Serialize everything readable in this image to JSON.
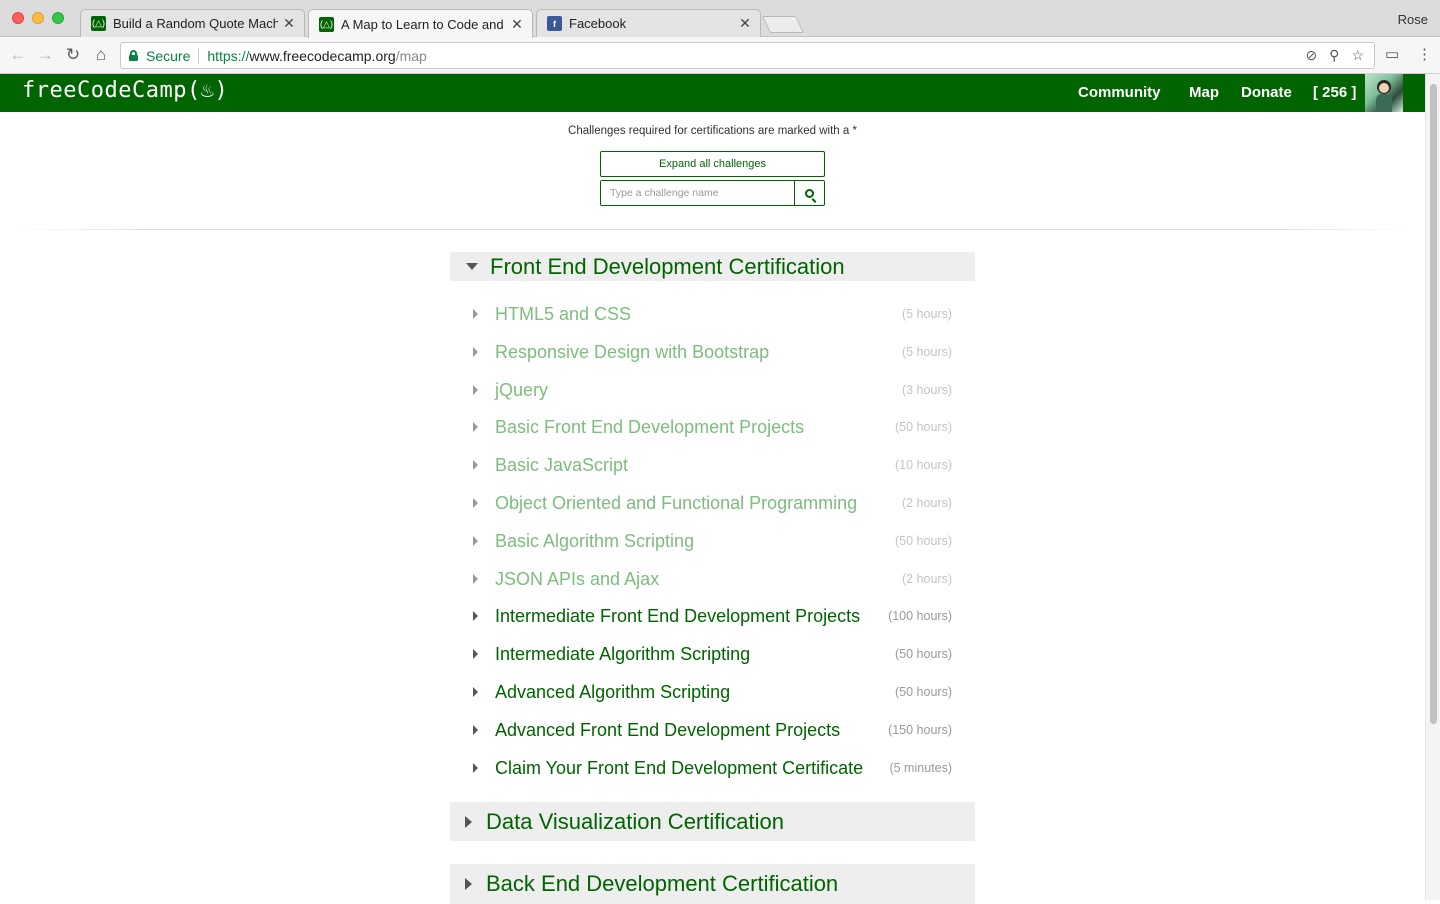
{
  "browser": {
    "tabs": [
      {
        "title": "Build a Random Quote Machine",
        "icon": "fcc-favicon"
      },
      {
        "title": "A Map to Learn to Code and Become a Software Engineer",
        "icon": "fcc-favicon"
      },
      {
        "title": "Facebook",
        "icon": "facebook-favicon"
      }
    ],
    "profile": "Rose",
    "secure_label": "Secure",
    "url_scheme": "https://",
    "url_host": "www.freecodecamp.org",
    "url_path": "/map"
  },
  "site": {
    "logo": "freeCodeCamp(",
    "logo_end": ")",
    "nav": {
      "community": "Community",
      "map": "Map",
      "donate": "Donate",
      "points": "[ 256 ]"
    },
    "brand_color": "#006400"
  },
  "map": {
    "intro": "Challenges required for certifications are marked with a *",
    "expand_label": "Expand all challenges",
    "search_placeholder": "Type a challenge name",
    "sections": [
      {
        "title": "Front End Development Certification",
        "expanded": true,
        "challenges": [
          {
            "title": "HTML5 and CSS",
            "time": "(5 hours)",
            "completed": true
          },
          {
            "title": "Responsive Design with Bootstrap",
            "time": "(5 hours)",
            "completed": true
          },
          {
            "title": "jQuery",
            "time": "(3 hours)",
            "completed": true
          },
          {
            "title": "Basic Front End Development Projects",
            "time": "(50 hours)",
            "completed": true
          },
          {
            "title": "Basic JavaScript",
            "time": "(10 hours)",
            "completed": true
          },
          {
            "title": "Object Oriented and Functional Programming",
            "time": "(2 hours)",
            "completed": true
          },
          {
            "title": "Basic Algorithm Scripting",
            "time": "(50 hours)",
            "completed": true
          },
          {
            "title": "JSON APIs and Ajax",
            "time": "(2 hours)",
            "completed": true
          },
          {
            "title": "Intermediate Front End Development Projects",
            "time": "(100 hours)",
            "completed": false
          },
          {
            "title": "Intermediate Algorithm Scripting",
            "time": "(50 hours)",
            "completed": false
          },
          {
            "title": "Advanced Algorithm Scripting",
            "time": "(50 hours)",
            "completed": false
          },
          {
            "title": "Advanced Front End Development Projects",
            "time": "(150 hours)",
            "completed": false
          },
          {
            "title": "Claim Your Front End Development Certificate",
            "time": "(5 minutes)",
            "completed": false
          }
        ]
      },
      {
        "title": "Data Visualization Certification",
        "expanded": false
      },
      {
        "title": "Back End Development Certification",
        "expanded": false
      }
    ]
  }
}
